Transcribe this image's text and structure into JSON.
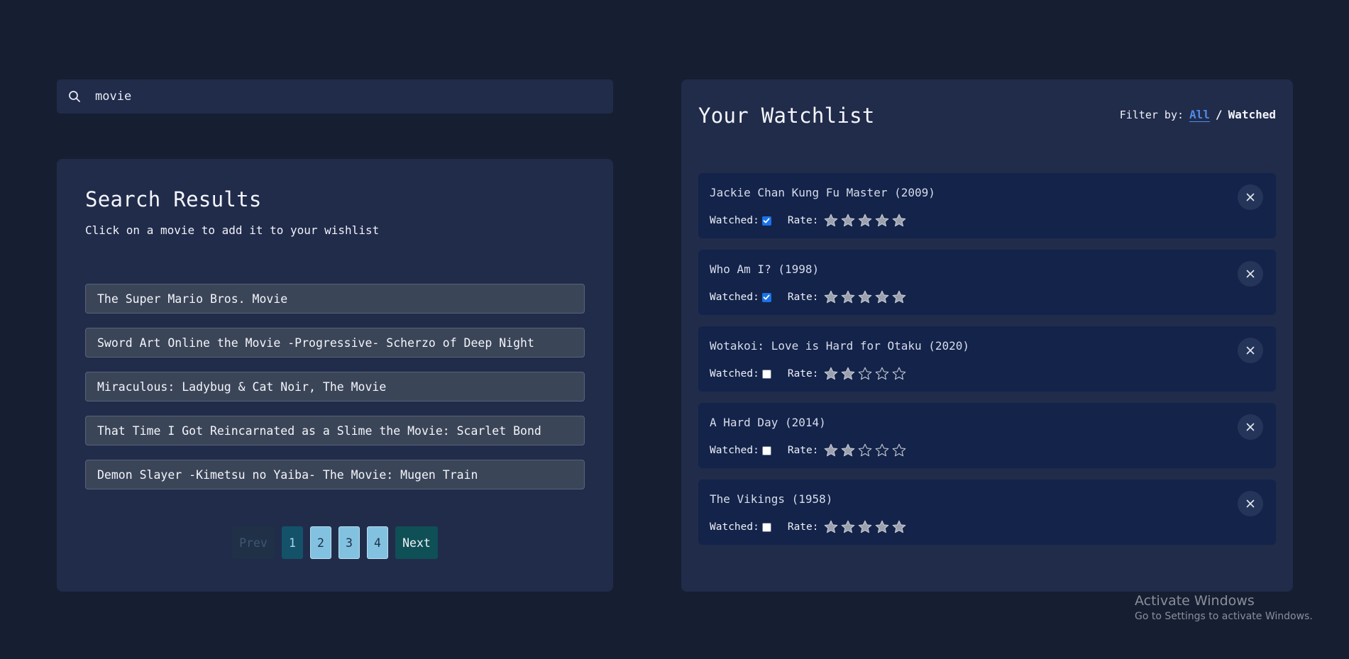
{
  "search": {
    "value": "movie",
    "placeholder": ""
  },
  "results": {
    "title": "Search Results",
    "subtitle": "Click on a movie to add it to your wishlist",
    "items": [
      "The Super Mario Bros. Movie",
      "Sword Art Online the Movie -Progressive- Scherzo of Deep Night",
      "Miraculous: Ladybug & Cat Noir, The Movie",
      "That Time I Got Reincarnated as a Slime the Movie: Scarlet Bond",
      "Demon Slayer -Kimetsu no Yaiba- The Movie: Mugen Train"
    ]
  },
  "pagination": {
    "prev": "Prev",
    "pages": [
      "1",
      "2",
      "3",
      "4"
    ],
    "active_page": "1",
    "next": "Next"
  },
  "watchlist": {
    "title": "Your Watchlist",
    "filter_label": "Filter by:",
    "filter_all": "All",
    "filter_sep": "/",
    "filter_watched": "Watched",
    "watched_label": "Watched:",
    "rate_label": "Rate:",
    "items": [
      {
        "title": "Jackie Chan Kung Fu Master (2009)",
        "watched": true,
        "rating": 5
      },
      {
        "title": "Who Am I? (1998)",
        "watched": true,
        "rating": 5
      },
      {
        "title": "Wotakoi: Love is Hard for Otaku (2020)",
        "watched": false,
        "rating": 2
      },
      {
        "title": "A Hard Day (2014)",
        "watched": false,
        "rating": 2
      },
      {
        "title": "The Vikings (1958)",
        "watched": false,
        "rating": 5
      }
    ]
  },
  "watermark": {
    "line1": "Activate Windows",
    "line2": "Go to Settings to activate Windows."
  },
  "colors": {
    "background": "#161e31",
    "panel": "#212c4b",
    "card": "#13234a",
    "accent": "#4f8be8",
    "star_filled": "#9aa0ad"
  }
}
